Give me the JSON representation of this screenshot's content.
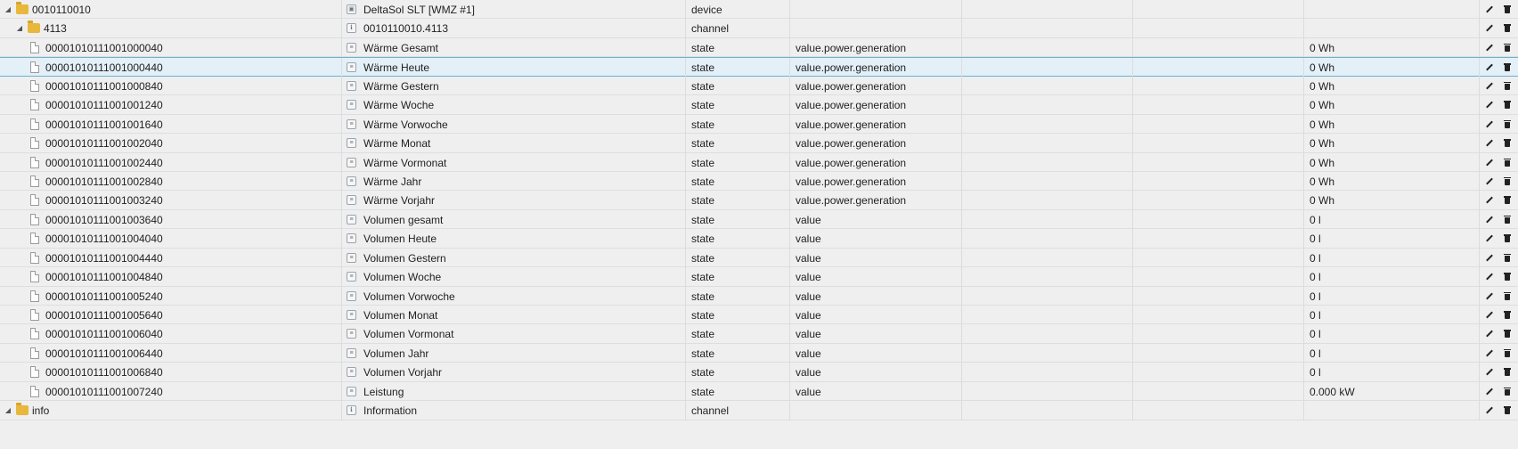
{
  "rows": [
    {
      "id": "0010110010",
      "name": "DeltaSol SLT [WMZ #1]",
      "type": "device",
      "role": "",
      "value": "",
      "kind": "folder",
      "level": 0,
      "icon": "device-icon"
    },
    {
      "id": "4113",
      "name": "0010110010.4113",
      "type": "channel",
      "role": "",
      "value": "",
      "kind": "folder",
      "level": 1,
      "icon": "channel-icon"
    },
    {
      "id": "00001010111001000040",
      "name": "Wärme Gesamt",
      "type": "state",
      "role": "value.power.generation",
      "value": "0 Wh",
      "kind": "file",
      "level": 2,
      "icon": "state-icon"
    },
    {
      "id": "00001010111001000440",
      "name": "Wärme Heute",
      "type": "state",
      "role": "value.power.generation",
      "value": "0 Wh",
      "kind": "file",
      "level": 2,
      "icon": "state-icon",
      "selected": true
    },
    {
      "id": "00001010111001000840",
      "name": "Wärme Gestern",
      "type": "state",
      "role": "value.power.generation",
      "value": "0 Wh",
      "kind": "file",
      "level": 2,
      "icon": "state-icon"
    },
    {
      "id": "00001010111001001240",
      "name": "Wärme Woche",
      "type": "state",
      "role": "value.power.generation",
      "value": "0 Wh",
      "kind": "file",
      "level": 2,
      "icon": "state-icon"
    },
    {
      "id": "00001010111001001640",
      "name": "Wärme Vorwoche",
      "type": "state",
      "role": "value.power.generation",
      "value": "0 Wh",
      "kind": "file",
      "level": 2,
      "icon": "state-icon"
    },
    {
      "id": "00001010111001002040",
      "name": "Wärme Monat",
      "type": "state",
      "role": "value.power.generation",
      "value": "0 Wh",
      "kind": "file",
      "level": 2,
      "icon": "state-icon"
    },
    {
      "id": "00001010111001002440",
      "name": "Wärme Vormonat",
      "type": "state",
      "role": "value.power.generation",
      "value": "0 Wh",
      "kind": "file",
      "level": 2,
      "icon": "state-icon"
    },
    {
      "id": "00001010111001002840",
      "name": "Wärme Jahr",
      "type": "state",
      "role": "value.power.generation",
      "value": "0 Wh",
      "kind": "file",
      "level": 2,
      "icon": "state-icon"
    },
    {
      "id": "00001010111001003240",
      "name": "Wärme Vorjahr",
      "type": "state",
      "role": "value.power.generation",
      "value": "0 Wh",
      "kind": "file",
      "level": 2,
      "icon": "state-icon"
    },
    {
      "id": "00001010111001003640",
      "name": "Volumen gesamt",
      "type": "state",
      "role": "value",
      "value": "0 l",
      "kind": "file",
      "level": 2,
      "icon": "state-icon"
    },
    {
      "id": "00001010111001004040",
      "name": "Volumen Heute",
      "type": "state",
      "role": "value",
      "value": "0 l",
      "kind": "file",
      "level": 2,
      "icon": "state-icon"
    },
    {
      "id": "00001010111001004440",
      "name": "Volumen Gestern",
      "type": "state",
      "role": "value",
      "value": "0 l",
      "kind": "file",
      "level": 2,
      "icon": "state-icon"
    },
    {
      "id": "00001010111001004840",
      "name": "Volumen Woche",
      "type": "state",
      "role": "value",
      "value": "0 l",
      "kind": "file",
      "level": 2,
      "icon": "state-icon"
    },
    {
      "id": "00001010111001005240",
      "name": "Volumen Vorwoche",
      "type": "state",
      "role": "value",
      "value": "0 l",
      "kind": "file",
      "level": 2,
      "icon": "state-icon"
    },
    {
      "id": "00001010111001005640",
      "name": "Volumen Monat",
      "type": "state",
      "role": "value",
      "value": "0 l",
      "kind": "file",
      "level": 2,
      "icon": "state-icon"
    },
    {
      "id": "00001010111001006040",
      "name": "Volumen Vormonat",
      "type": "state",
      "role": "value",
      "value": "0 l",
      "kind": "file",
      "level": 2,
      "icon": "state-icon"
    },
    {
      "id": "00001010111001006440",
      "name": "Volumen Jahr",
      "type": "state",
      "role": "value",
      "value": "0 l",
      "kind": "file",
      "level": 2,
      "icon": "state-icon"
    },
    {
      "id": "00001010111001006840",
      "name": "Volumen Vorjahr",
      "type": "state",
      "role": "value",
      "value": "0 l",
      "kind": "file",
      "level": 2,
      "icon": "state-icon"
    },
    {
      "id": "00001010111001007240",
      "name": "Leistung",
      "type": "state",
      "role": "value",
      "value": "0.000 kW",
      "kind": "file",
      "level": 2,
      "icon": "state-icon"
    },
    {
      "id": "info",
      "name": "Information",
      "type": "channel",
      "role": "",
      "value": "",
      "kind": "folder",
      "level": 0,
      "icon": "channel-icon"
    }
  ],
  "colors": {
    "background": "#efefef",
    "selected_row": "#e3f0f8",
    "selected_border": "#6cb1d1",
    "folder": "#e8b83c"
  }
}
